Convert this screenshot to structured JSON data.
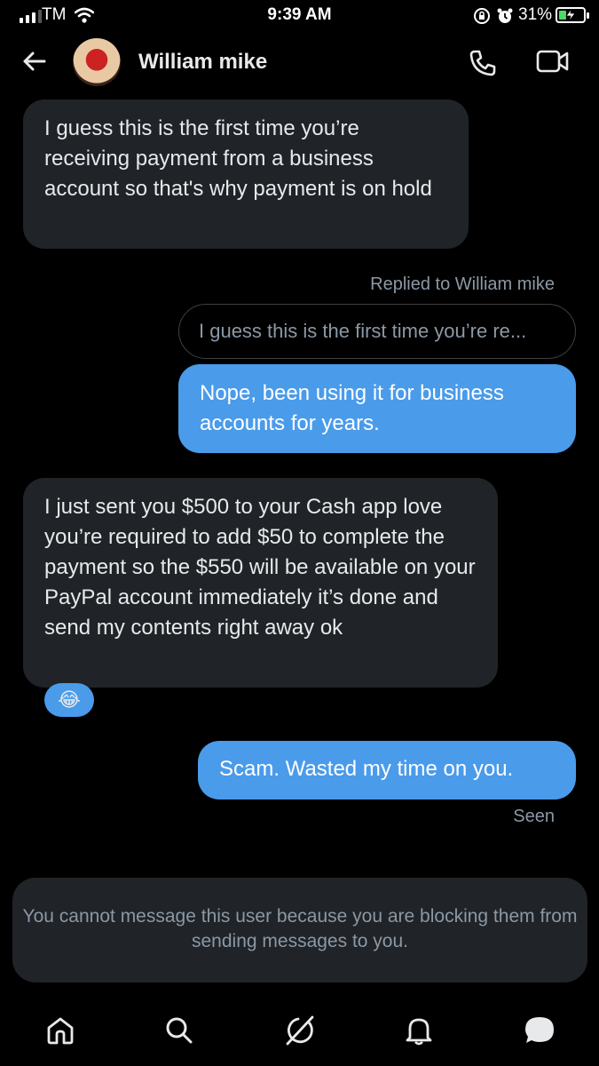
{
  "status_bar": {
    "carrier": "TM",
    "time": "9:39 AM",
    "battery_percent": "31%",
    "battery_level": 0.31,
    "icons": [
      "signal-icon",
      "wifi-icon",
      "rotation-lock-icon",
      "alarm-icon",
      "battery-charging-icon"
    ]
  },
  "header": {
    "contact_name": "William mike",
    "icons": [
      "back-arrow-icon",
      "avatar",
      "phone-call-icon",
      "video-call-icon"
    ]
  },
  "messages": [
    {
      "direction": "incoming",
      "text": "I guess this is the first time you’re receiving payment from a business account so that's why payment is on hold"
    },
    {
      "direction": "outgoing",
      "reply_label": "Replied to William mike",
      "quoted": "I guess this is the first time you’re re...",
      "text": "Nope, been using it for business accounts for years."
    },
    {
      "direction": "incoming",
      "text": "I just sent you $500 to your  Cash app love you’re required to add $50 to complete the payment so the $550 will be available on your PayPal account immediately it’s done and send my contents right away ok",
      "reaction": "😂"
    },
    {
      "direction": "outgoing",
      "text": "Scam. Wasted my time on you.",
      "status": "Seen"
    }
  ],
  "blocked_notice": "You cannot message this user because you are blocking them from sending messages to you.",
  "tab_bar": [
    "home-icon",
    "search-icon",
    "grok-icon",
    "notifications-icon",
    "messages-icon"
  ],
  "colors": {
    "background": "#000000",
    "incoming_bubble": "#202327",
    "outgoing_bubble": "#4a9bea",
    "muted_text": "#8b98a5"
  }
}
